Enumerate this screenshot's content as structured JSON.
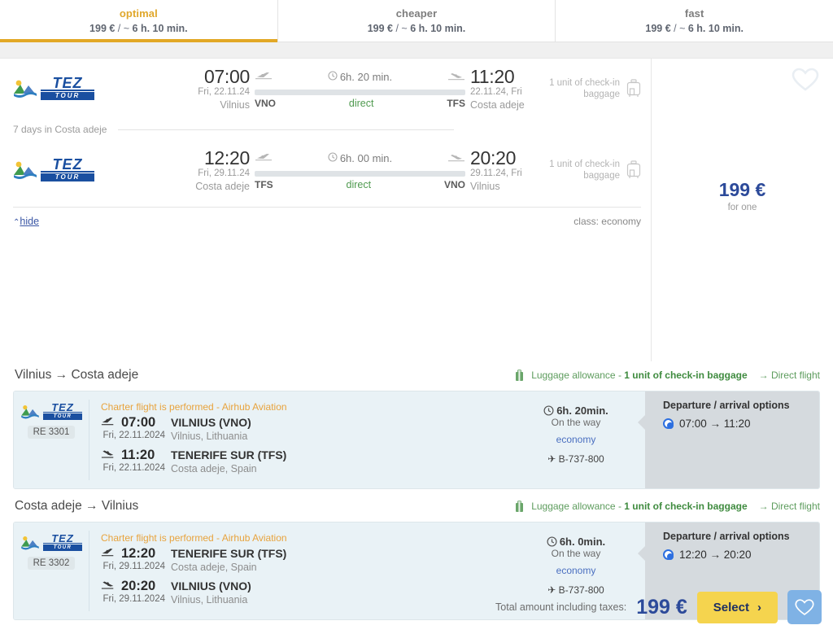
{
  "tabs": [
    {
      "name": "optimal",
      "price": "199 €",
      "sep": " / ~ ",
      "duration": "6 h. 10 min.",
      "active": true
    },
    {
      "name": "cheaper",
      "price": "199 €",
      "sep": " / ~ ",
      "duration": "6 h. 10 min.",
      "active": false
    },
    {
      "name": "fast",
      "price": "199 €",
      "sep": " / ~ ",
      "duration": "6 h. 10 min.",
      "active": false
    }
  ],
  "summary": {
    "airline": {
      "name": "TEZ",
      "sub": "TOUR"
    },
    "outbound": {
      "dep_time": "07:00",
      "dep_date": "Fri, 22.11.24",
      "dep_city": "Vilnius",
      "dep_iata": "VNO",
      "duration": "6h. 20 min.",
      "stops": "direct",
      "arr_time": "11:20",
      "arr_date": "22.11.24, Fri",
      "arr_city": "Costa adeje",
      "arr_iata": "TFS",
      "baggage": "1 unit of check-in baggage"
    },
    "stay": "7 days in Costa adeje",
    "inbound": {
      "dep_time": "12:20",
      "dep_date": "Fri, 29.11.24",
      "dep_city": "Costa adeje",
      "dep_iata": "TFS",
      "duration": "6h. 00 min.",
      "stops": "direct",
      "arr_time": "20:20",
      "arr_date": "29.11.24, Fri",
      "arr_city": "Vilnius",
      "arr_iata": "VNO",
      "baggage": "1 unit of check-in baggage"
    },
    "hide_label": "hide",
    "hide_caret": "⌃",
    "class_label": "class: economy",
    "price": "199 €",
    "price_note": "for one"
  },
  "routes": [
    {
      "title": "Vilnius → Costa adeje",
      "luggage_prefix": "Luggage allowance - ",
      "luggage_value": "1 unit of check-in baggage",
      "direct_label": "→ Direct flight",
      "flight_code": "RE 3301",
      "charter": "Charter flight is performed - Airhub Aviation",
      "legs": [
        {
          "icon": "takeoff",
          "time": "07:00",
          "airport": "VILNIUS (VNO)",
          "date": "Fri, 22.11.2024",
          "city": "Vilnius, Lithuania"
        },
        {
          "icon": "landing",
          "time": "11:20",
          "airport": "TENERIFE SUR (TFS)",
          "date": "Fri, 22.11.2024",
          "city": "Costa adeje, Spain"
        }
      ],
      "duration": "6h. 20min.",
      "on_the_way": "On the way",
      "cabin_class": "economy",
      "aircraft": "B-737-800",
      "options_title": "Departure / arrival options",
      "option_selected": "07:00 → 11:20"
    },
    {
      "title": "Costa adeje → Vilnius",
      "luggage_prefix": "Luggage allowance - ",
      "luggage_value": "1 unit of check-in baggage",
      "direct_label": "→ Direct flight",
      "flight_code": "RE 3302",
      "charter": "Charter flight is performed - Airhub Aviation",
      "legs": [
        {
          "icon": "takeoff",
          "time": "12:20",
          "airport": "TENERIFE SUR (TFS)",
          "date": "Fri, 29.11.2024",
          "city": "Costa adeje, Spain"
        },
        {
          "icon": "landing",
          "time": "20:20",
          "airport": "VILNIUS (VNO)",
          "date": "Fri, 29.11.2024",
          "city": "Vilnius, Lithuania"
        }
      ],
      "duration": "6h. 0min.",
      "on_the_way": "On the way",
      "cabin_class": "economy",
      "aircraft": "B-737-800",
      "options_title": "Departure / arrival options",
      "option_selected": "12:20 → 20:20"
    }
  ],
  "footer": {
    "total_label": "Total amount including taxes:",
    "total_amount": "199 €",
    "select_label": "Select",
    "select_caret": "›"
  },
  "colors": {
    "accent_yellow": "#e2a826",
    "brand_blue": "#2c4a9a",
    "green": "#5d9c5d",
    "charter_orange": "#e8a33d",
    "panel_blue": "#e9f2f6",
    "panel_gray": "#d5dade",
    "select_button": "#f5d44e",
    "fav_button": "#7fb2e5"
  }
}
